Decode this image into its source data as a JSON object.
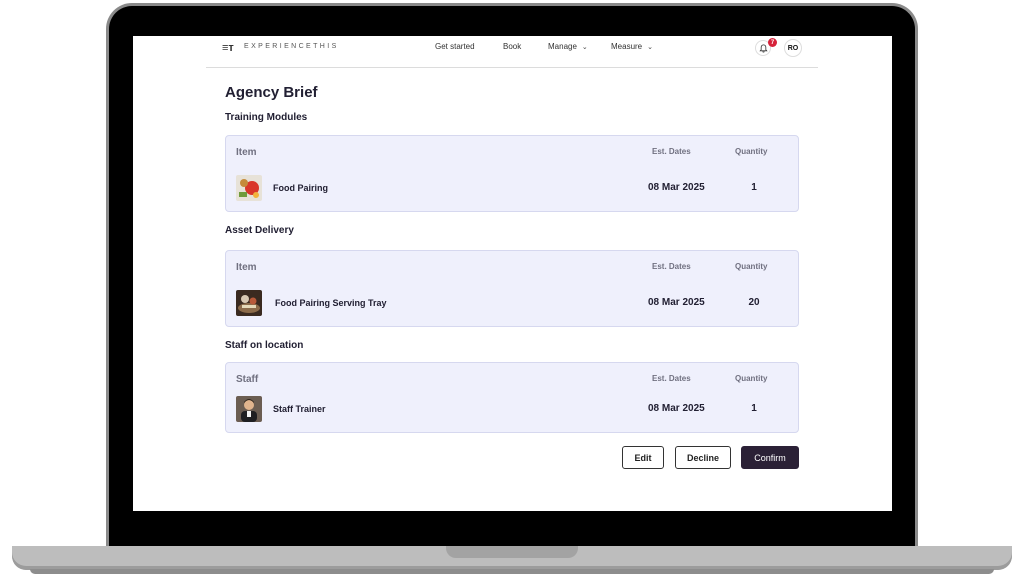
{
  "nav": {
    "logo_icon": "≡т",
    "brand": "EXPERIENCETHIS",
    "links": [
      {
        "label": "Get started",
        "has_dropdown": false
      },
      {
        "label": "Book",
        "has_dropdown": false
      },
      {
        "label": "Manage",
        "has_dropdown": true
      },
      {
        "label": "Measure",
        "has_dropdown": true
      }
    ],
    "notification_count": "7",
    "user_initials": "RO",
    "bell_icon": "bell-icon",
    "chevron_icon": "chevron-down-icon"
  },
  "page": {
    "title": "Agency Brief"
  },
  "sections": [
    {
      "title": "Training Modules",
      "headers": {
        "item": "Item",
        "dates": "Est. Dates",
        "quantity": "Quantity"
      },
      "rows": [
        {
          "name": "Food Pairing",
          "date": "08 Mar 2025",
          "quantity": "1"
        }
      ]
    },
    {
      "title": "Asset Delivery",
      "headers": {
        "item": "Item",
        "dates": "Est. Dates",
        "quantity": "Quantity"
      },
      "rows": [
        {
          "name": "Food Pairing Serving Tray",
          "date": "08 Mar 2025",
          "quantity": "20"
        }
      ]
    },
    {
      "title": "Staff on location",
      "headers": {
        "item": "Staff",
        "dates": "Est. Dates",
        "quantity": "Quantity"
      },
      "rows": [
        {
          "name": "Staff Trainer",
          "date": "08 Mar 2025",
          "quantity": "1"
        }
      ]
    }
  ],
  "actions": {
    "edit": "Edit",
    "decline": "Decline",
    "confirm": "Confirm"
  },
  "colors": {
    "accent": "#2b2136",
    "card_bg": "#eff0fc",
    "badge": "#d6223a"
  }
}
